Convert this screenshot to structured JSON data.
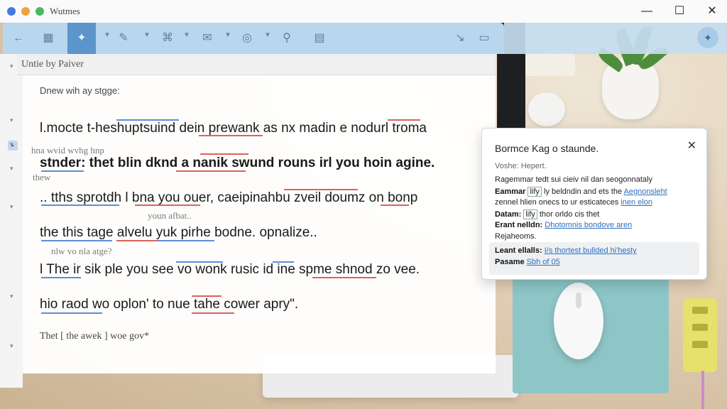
{
  "window": {
    "title": "Wutmes",
    "min_icon": "minimize-icon",
    "max_icon": "maximize-icon",
    "close_icon": "close-icon"
  },
  "colors": {
    "toolbar": "#b9d6ef",
    "toolbar_active": "#5b95cc",
    "underline_blue": "#5b8fd6",
    "underline_red": "#d9645a",
    "link": "#2f6fc0"
  },
  "toolbar": {
    "icons": [
      "back-arrow-icon",
      "grid-icon",
      "magic-icon",
      "edit-icon",
      "text-icon",
      "mail-icon",
      "record-icon",
      "search-icon",
      "save-icon",
      "collapse-icon",
      "layout-icon",
      "assistant-icon"
    ]
  },
  "document": {
    "header": "Untie by Paiver",
    "subheading": "Dnew wih ay stgge:",
    "lines": [
      "l.mocte t-heshuptsuind dein prewank as nx madin e nodurl troma",
      "stnder: thet blin dknd a nanik swund rouns irl you hoin agine.",
      ".. tths sprotdh l bna you ouer, caeipinahbu zveil doumz on bonp",
      "the this tage alvelu yuk pirhe bodne. opnalize..",
      "l The ir sik ple you see vo wonk rusic id ine spme shnod zo vee.",
      "hio raod wo oplon' to nue tahe cower apry\"."
    ],
    "ghost_lines": [
      "hna  wvid  wvhg  hnp",
      "thew",
      "youn afbat..",
      "nlw vo nla atge?"
    ],
    "footer": "Thet  [  the awek  ]  woe gov*"
  },
  "popup": {
    "title": "Bormce Kag o staunde.",
    "subtitle": "Voshe: Hepert.",
    "rows": [
      {
        "label": "",
        "text": "Ragemmar tedt sui cieiv nil dan seogonnataly"
      },
      {
        "label": "Eammar",
        "box": "lify",
        "text": " ly beldndin and ets the ",
        "link": "Aegnonsleht"
      },
      {
        "label": "",
        "text": "zennel hlien onecs to ur esticateces ",
        "link": "inen elon"
      },
      {
        "label": "Datam:",
        "box": "lify",
        "text": " thor orldo cis thet"
      },
      {
        "label": "Erant nelldn:",
        "box": "",
        "text": " ",
        "link": "Dhotomnis bondove aren"
      },
      {
        "label": "",
        "text": "Rejaheoms."
      },
      {
        "label": "Leant ellalls:",
        "box": "",
        "text": " ",
        "link": "I/s thortest bullded hi'hesty"
      },
      {
        "label": "Pasame",
        "box": "",
        "text": " ",
        "link": "Sbh of 05"
      }
    ]
  }
}
